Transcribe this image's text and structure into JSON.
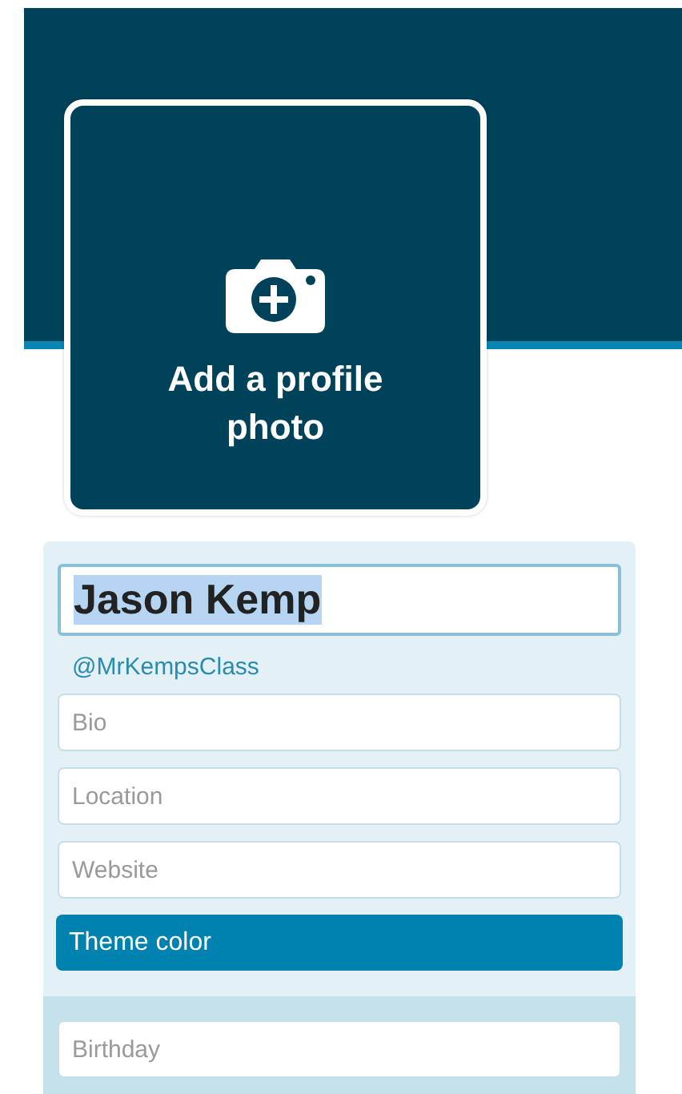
{
  "avatar": {
    "label": "Add a profile photo"
  },
  "form": {
    "name": {
      "value": "Jason Kemp",
      "text_selected": true
    },
    "handle": "@MrKempsClass",
    "fields": [
      {
        "placeholder": "Bio"
      },
      {
        "placeholder": "Location"
      },
      {
        "placeholder": "Website"
      }
    ],
    "theme_button": "Theme color",
    "birthday": {
      "placeholder": "Birthday"
    }
  }
}
